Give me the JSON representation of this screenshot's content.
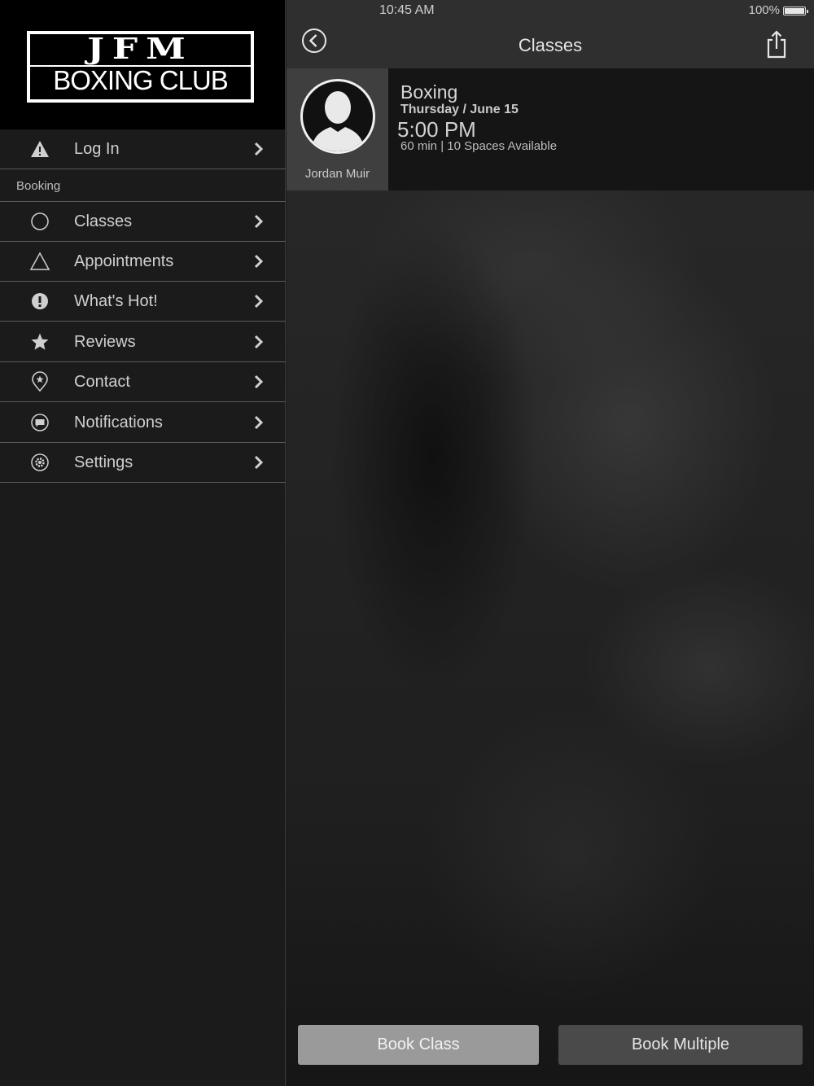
{
  "status": {
    "time": "10:45 AM",
    "battery": "100%",
    "battery_level": 1.0
  },
  "sidebar": {
    "logo": {
      "line1": "JFM",
      "line2": "BOXING CLUB"
    },
    "login": {
      "label": "Log In",
      "icon": "warning-icon"
    },
    "section": "Booking",
    "items": [
      {
        "label": "Classes",
        "icon": "circle-outline-icon"
      },
      {
        "label": "Appointments",
        "icon": "triangle-outline-icon"
      },
      {
        "label": "What's Hot!",
        "icon": "exclamation-icon"
      },
      {
        "label": "Reviews",
        "icon": "star-icon"
      },
      {
        "label": "Contact",
        "icon": "location-pin-icon"
      },
      {
        "label": "Notifications",
        "icon": "chat-bubble-icon"
      },
      {
        "label": "Settings",
        "icon": "gear-icon"
      }
    ]
  },
  "header": {
    "title": "Classes",
    "back_icon": "back-circle-icon",
    "share_icon": "share-icon"
  },
  "class_card": {
    "instructor": "Jordan Muir",
    "name": "Boxing",
    "date": "Thursday / June 15",
    "time": "5:00 PM",
    "meta": "60 min | 10 Spaces Available"
  },
  "actions": {
    "book_class": "Book Class",
    "book_multiple": "Book Multiple"
  },
  "colors": {
    "sidebar_bg": "#1b1b1b",
    "bar_bg": "#2f2f2f",
    "primary_button": "#9a9a9a",
    "secondary_button": "#4a4a4a"
  }
}
